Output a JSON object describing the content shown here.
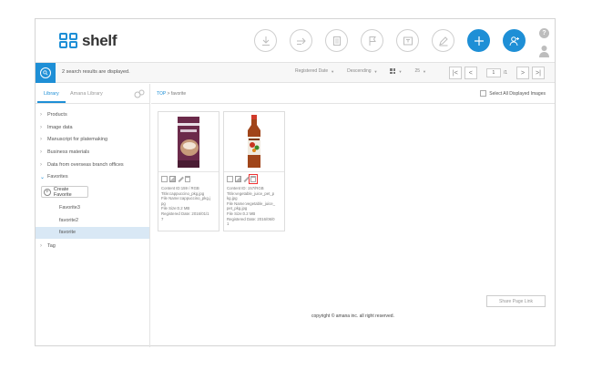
{
  "app": {
    "name": "shelf"
  },
  "colors": {
    "accent": "#1e8fd6",
    "selected_bg": "#d9e8f5",
    "highlight": "#e33333"
  },
  "header": {
    "tools": [
      {
        "name": "download-icon"
      },
      {
        "name": "move-icon"
      },
      {
        "name": "document-icon"
      },
      {
        "name": "flag-icon"
      },
      {
        "name": "lightbox-icon"
      },
      {
        "name": "edit-icon"
      },
      {
        "name": "add-icon"
      },
      {
        "name": "user-add-icon"
      }
    ],
    "help_label": "?"
  },
  "search": {
    "result_text": "2 search results are displayed."
  },
  "sort": {
    "field_label": "Registered Date",
    "order_label": "Descending",
    "per_page": "25"
  },
  "pager": {
    "current": "1",
    "total": "/1"
  },
  "sidebar": {
    "tabs": [
      "Library",
      "Amana Library"
    ],
    "tree": [
      {
        "label": "Products"
      },
      {
        "label": "Image data"
      },
      {
        "label": "Manuscript for platemaking"
      },
      {
        "label": "Business materials"
      },
      {
        "label": "Data from overseas branch offices"
      }
    ],
    "favorites": {
      "label": "Favorites",
      "create_label": "Create Favorite",
      "items": [
        "Favorite3",
        "favorite2",
        "favorite"
      ]
    },
    "tag_label": "Tag"
  },
  "breadcrumb": {
    "root": "TOP",
    "separator": ">",
    "current": "favorite"
  },
  "select_all_label": "Select All Displayed Images",
  "assets": [
    {
      "meta": [
        "Content ID:159 / RGB",
        "Title:cappuccino_pkg.jpg",
        "File Name:cappuccino_pkg.j",
        "pg",
        "File Size:0.2 MB",
        "Registered Date: 2016/01/1",
        "7"
      ]
    },
    {
      "meta": [
        "Content ID: 157/RGB",
        "Title:vegetable_juice_pet_p",
        "kg.jpg",
        "File Name:vegetable_juice_",
        "pet_pkg.jpg",
        "File Size:0.2 MB",
        "Registered Date: 2016/06/0",
        "1"
      ]
    }
  ],
  "share_label": "Share Page Link",
  "copyright": "copyright © amana inc. all right reserved."
}
